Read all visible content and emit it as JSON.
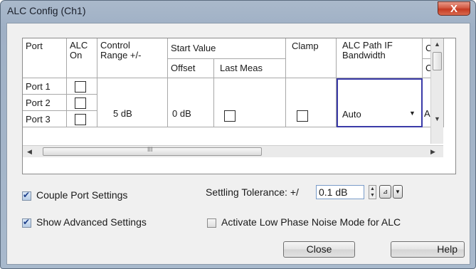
{
  "window": {
    "title": "ALC Config (Ch1)",
    "close_glyph": "X"
  },
  "grid": {
    "headers": {
      "port": "Port",
      "alc_on": "ALC\nOn",
      "control_range": "Control\nRange +/-",
      "start_value": "Start Value",
      "offset": "Offset",
      "last_meas": "Last Meas",
      "clamp": "Clamp",
      "alc_path_if_bw": "ALC Path IF\nBandwidth",
      "cor": "Cor",
      "coe": "Coe"
    },
    "rows": [
      {
        "port": "Port 1",
        "alc_on": false
      },
      {
        "port": "Port 2",
        "alc_on": false
      },
      {
        "port": "Port 3",
        "alc_on": false
      }
    ],
    "control_range_value": "5 dB",
    "offset_value": "0 dB",
    "last_meas_checked": false,
    "clamp_checked": false,
    "if_bandwidth_value": "Auto",
    "partial_col_value": "Aut",
    "scroll_thumb_glyph": "III"
  },
  "options": {
    "couple_ports": {
      "label": "Couple Port Settings",
      "checked": true
    },
    "show_advanced": {
      "label": "Show Advanced Settings",
      "checked": true
    },
    "low_phase_noise": {
      "label": "Activate Low Phase Noise Mode for ALC",
      "checked": false
    }
  },
  "settling": {
    "label": "Settling Tolerance: +/",
    "value": "0.1 dB"
  },
  "buttons": {
    "close": "Close",
    "help": "Help"
  },
  "colors": {
    "accent": "#2a6bd1",
    "selection_border": "#3a3aa8"
  }
}
